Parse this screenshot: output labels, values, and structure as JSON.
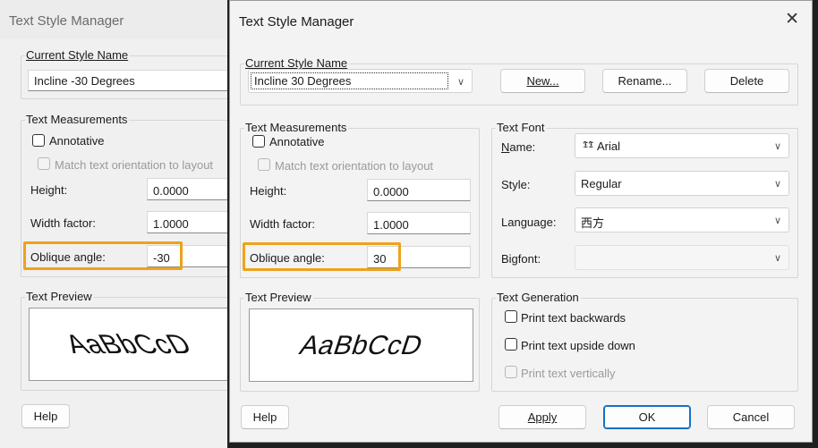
{
  "dialogs": {
    "left": {
      "title": "Text Style Manager",
      "current_style_legend": "Current Style Name",
      "current_style_value": "Incline -30 Degrees",
      "text_measurements_legend": "Text Measurements",
      "annotative_label": "Annotative",
      "match_orientation_label": "Match text orientation to layout",
      "height_label": "Height:",
      "height_value": "0.0000",
      "width_factor_label": "Width factor:",
      "width_factor_value": "1.0000",
      "oblique_label": "Oblique angle:",
      "oblique_value": "-30",
      "text_preview_legend": "Text Preview",
      "preview_sample": "AaBbCcD",
      "help_label": "Help"
    },
    "right": {
      "title": "Text Style Manager",
      "close_glyph": "✕",
      "current_style_legend": "Current Style Name",
      "current_style_value": "Incline 30 Degrees",
      "new_label": "New...",
      "rename_label": "Rename...",
      "delete_label": "Delete",
      "text_measurements_legend": "Text Measurements",
      "annotative_label": "Annotative",
      "match_orientation_label": "Match text orientation to layout",
      "height_label": "Height:",
      "height_value": "0.0000",
      "width_factor_label": "Width factor:",
      "width_factor_value": "1.0000",
      "oblique_label": "Oblique angle:",
      "oblique_value": "30",
      "text_font_legend": "Text Font",
      "name_label": "Name:",
      "name_value": "Arial",
      "style_label": "Style:",
      "style_value": "Regular",
      "language_label": "Language:",
      "language_value": "西方",
      "bigfont_label": "Bigfont:",
      "bigfont_value": "",
      "text_preview_legend": "Text Preview",
      "preview_sample": "AaBbCcD",
      "text_generation_legend": "Text Generation",
      "backwards_label": "Print text backwards",
      "upside_down_label": "Print text upside down",
      "vertically_label": "Print text vertically",
      "help_label": "Help",
      "apply_label": "Apply",
      "ok_label": "OK",
      "cancel_label": "Cancel"
    }
  },
  "icons": {
    "chevron": "chevron-down-icon",
    "font_type": "truetype-font-icon",
    "close": "close-icon"
  },
  "colors": {
    "highlight": "#eea21a",
    "primary_button_border": "#1570c6",
    "dialog_background": "#f3f3f3"
  }
}
